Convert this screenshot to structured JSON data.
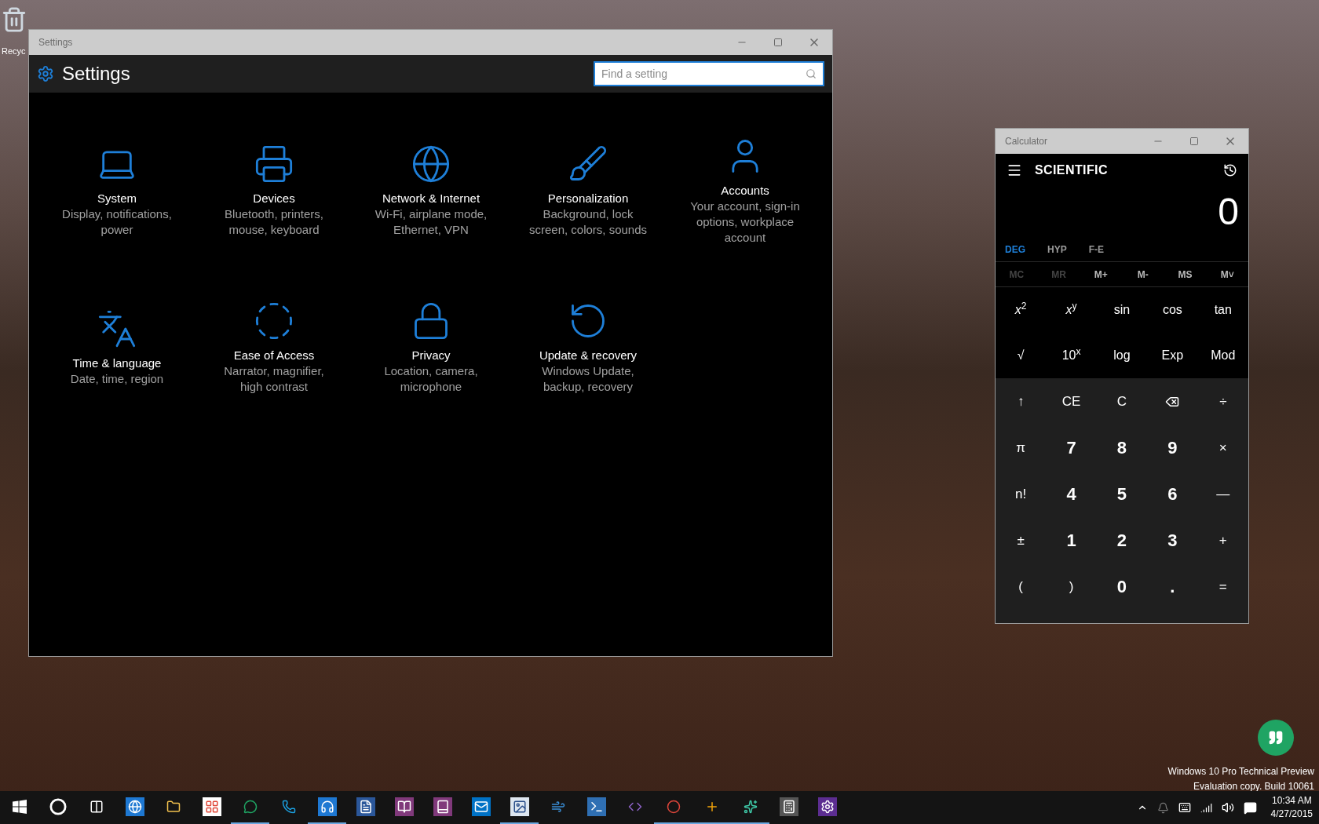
{
  "desktop": {
    "recycle_bin_label": "Recyc",
    "watermark": [
      "Windows 10 Pro Technical Preview",
      "Evaluation copy. Build 10061"
    ]
  },
  "settings_window": {
    "title": "Settings",
    "header": "Settings",
    "search": {
      "placeholder": "Find a setting"
    },
    "categories": [
      {
        "kind": "system",
        "title": "System",
        "subtitle": "Display, notifications, power"
      },
      {
        "kind": "devices",
        "title": "Devices",
        "subtitle": "Bluetooth, printers, mouse, keyboard"
      },
      {
        "kind": "network",
        "title": "Network & Internet",
        "subtitle": "Wi-Fi, airplane mode, Ethernet, VPN"
      },
      {
        "kind": "personalization",
        "title": "Personalization",
        "subtitle": "Background, lock screen, colors, sounds"
      },
      {
        "kind": "accounts",
        "title": "Accounts",
        "subtitle": "Your account, sign-in options, workplace account"
      },
      {
        "kind": "time",
        "title": "Time & language",
        "subtitle": "Date, time, region"
      },
      {
        "kind": "ease",
        "title": "Ease of Access",
        "subtitle": "Narrator, magnifier, high contrast"
      },
      {
        "kind": "privacy",
        "title": "Privacy",
        "subtitle": "Location, camera, microphone"
      },
      {
        "kind": "update",
        "title": "Update & recovery",
        "subtitle": "Windows Update, backup, recovery"
      }
    ]
  },
  "calculator_window": {
    "title": "Calculator",
    "mode": "SCIENTIFIC",
    "display": "0",
    "angle_modes": [
      {
        "label": "DEG",
        "selected": true
      },
      {
        "label": "HYP",
        "selected": false
      },
      {
        "label": "F-E",
        "selected": false
      }
    ],
    "memory_buttons": [
      {
        "label": "MC",
        "disabled": true
      },
      {
        "label": "MR",
        "disabled": true
      },
      {
        "label": "M+",
        "disabled": false
      },
      {
        "label": "M-",
        "disabled": false
      },
      {
        "label": "MS",
        "disabled": false
      },
      {
        "label": "M˅",
        "disabled": false
      }
    ],
    "function_keys": [
      {
        "label": "*x*$^{2}$"
      },
      {
        "label": "*x*$^{y}$"
      },
      {
        "label": "sin"
      },
      {
        "label": "cos"
      },
      {
        "label": "tan"
      },
      {
        "label": "√"
      },
      {
        "label": "10$^{x}$"
      },
      {
        "label": "log"
      },
      {
        "label": "Exp"
      },
      {
        "label": "Mod"
      }
    ],
    "keypad": [
      {
        "kind": "op",
        "label": "↑"
      },
      {
        "kind": "op",
        "label": "CE"
      },
      {
        "kind": "op",
        "label": "C"
      },
      {
        "kind": "backspace"
      },
      {
        "kind": "op",
        "label": "÷"
      },
      {
        "kind": "op",
        "label": "π"
      },
      {
        "kind": "digit",
        "label": "7"
      },
      {
        "kind": "digit",
        "label": "8"
      },
      {
        "kind": "digit",
        "label": "9"
      },
      {
        "kind": "op",
        "label": "×"
      },
      {
        "kind": "op",
        "label": "n!"
      },
      {
        "kind": "digit",
        "label": "4"
      },
      {
        "kind": "digit",
        "label": "5"
      },
      {
        "kind": "digit",
        "label": "6"
      },
      {
        "kind": "op",
        "label": "—"
      },
      {
        "kind": "op",
        "label": "±"
      },
      {
        "kind": "digit",
        "label": "1"
      },
      {
        "kind": "digit",
        "label": "2"
      },
      {
        "kind": "digit",
        "label": "3"
      },
      {
        "kind": "op",
        "label": "+"
      },
      {
        "kind": "op",
        "label": "("
      },
      {
        "kind": "op",
        "label": ")"
      },
      {
        "kind": "digit",
        "label": "0"
      },
      {
        "kind": "digit",
        "label": "."
      },
      {
        "kind": "op",
        "label": "="
      }
    ]
  },
  "taskbar": {
    "apps": [
      {
        "kind": "start",
        "running": false
      },
      {
        "kind": "cortana",
        "running": false
      },
      {
        "kind": "taskview",
        "running": false
      },
      {
        "kind": "browser",
        "running": false
      },
      {
        "kind": "folder",
        "running": false
      },
      {
        "kind": "store",
        "running": false
      },
      {
        "kind": "chat",
        "running": true
      },
      {
        "kind": "phone",
        "running": false
      },
      {
        "kind": "music",
        "running": true
      },
      {
        "kind": "word",
        "running": false
      },
      {
        "kind": "notebook",
        "running": false
      },
      {
        "kind": "notebook2",
        "running": false
      },
      {
        "kind": "mail",
        "running": false
      },
      {
        "kind": "picture",
        "running": true
      },
      {
        "kind": "wind",
        "running": false
      },
      {
        "kind": "terminal",
        "running": false
      },
      {
        "kind": "code",
        "running": false
      },
      {
        "kind": "chrome",
        "running": true
      },
      {
        "kind": "plus",
        "running": true
      },
      {
        "kind": "sparkle",
        "running": true
      },
      {
        "kind": "calculator",
        "running": false
      },
      {
        "kind": "settings",
        "running": false
      }
    ],
    "clock": {
      "time": "10:34 AM",
      "date": "4/27/2015"
    }
  }
}
